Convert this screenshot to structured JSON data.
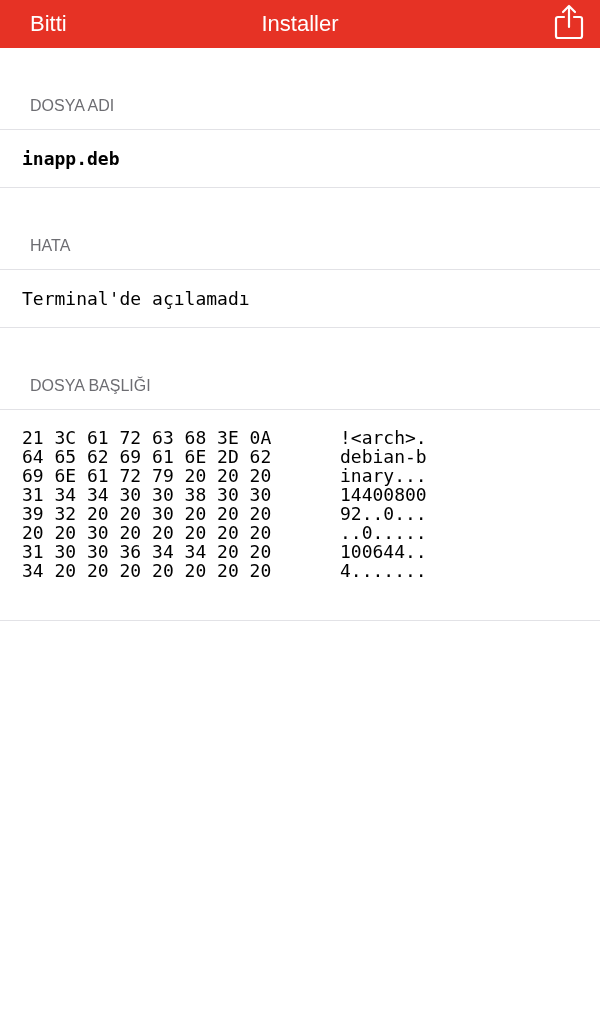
{
  "nav_bar": {
    "left_button": "Bitti",
    "title": "Installer"
  },
  "sections": [
    {
      "header": "DOSYA ADI",
      "kind": "bold",
      "value": "inapp.deb"
    },
    {
      "header": "HATA",
      "kind": "plain",
      "value": "Terminal'de açılamadı"
    },
    {
      "header": "DOSYA BAŞLIĞI",
      "kind": "hexdump",
      "rows": [
        {
          "hex": "21 3C 61 72 63 68 3E 0A",
          "ascii": "!<arch>."
        },
        {
          "hex": "64 65 62 69 61 6E 2D 62",
          "ascii": "debian-b"
        },
        {
          "hex": "69 6E 61 72 79 20 20 20",
          "ascii": "inary..."
        },
        {
          "hex": "31 34 34 30 30 38 30 30",
          "ascii": "14400800"
        },
        {
          "hex": "39 32 20 20 30 20 20 20",
          "ascii": "92..0..."
        },
        {
          "hex": "20 20 30 20 20 20 20 20",
          "ascii": "..0....."
        },
        {
          "hex": "31 30 30 36 34 34 20 20",
          "ascii": "100644.."
        },
        {
          "hex": "34 20 20 20 20 20 20 20",
          "ascii": "4......."
        }
      ]
    }
  ]
}
